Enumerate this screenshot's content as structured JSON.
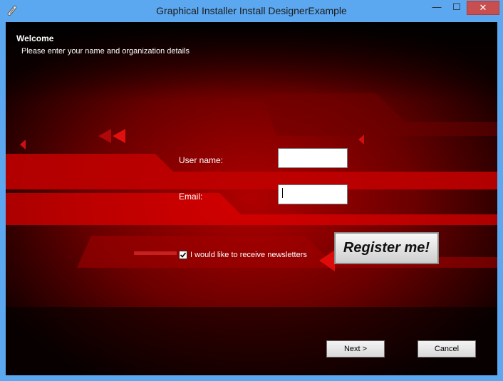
{
  "window": {
    "title": "Graphical Installer Install DesignerExample",
    "min_glyph": "—",
    "max_glyph": "☐",
    "close_glyph": "✕"
  },
  "header": {
    "title": "Welcome",
    "subtitle": "Please enter your name and organization details"
  },
  "form": {
    "username_label": "User name:",
    "username_value": "",
    "email_label": "Email:",
    "email_value": "",
    "newsletter_label": "I would like to receive newsletters",
    "newsletter_checked": true,
    "register_label": "Register me!"
  },
  "buttons": {
    "next_label": "Next >",
    "cancel_label": "Cancel"
  },
  "colors": {
    "accent_red": "#d40000",
    "window_frame": "#5ca8f0",
    "close_button": "#c74f50"
  }
}
